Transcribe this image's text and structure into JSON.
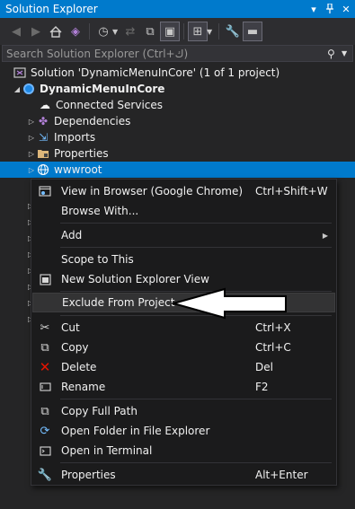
{
  "window": {
    "title": "Solution Explorer",
    "pin_icon": "pin-icon",
    "close_icon": "close-icon"
  },
  "search": {
    "placeholder": "Search Solution Explorer (Ctrl+ك)"
  },
  "tree": {
    "solution": "Solution 'DynamicMenuInCore' (1 of 1 project)",
    "project": "DynamicMenuInCore",
    "items": [
      "Connected Services",
      "Dependencies",
      "Imports",
      "Properties",
      "wwwroot"
    ]
  },
  "context_menu": {
    "items": [
      {
        "label": "View in Browser (Google Chrome)",
        "shortcut": "Ctrl+Shift+W",
        "icon": "browser-icon"
      },
      {
        "label": "Browse With...",
        "shortcut": "",
        "icon": ""
      },
      {
        "label": "Add",
        "shortcut": "",
        "icon": "",
        "submenu": true
      },
      {
        "label": "Scope to This",
        "shortcut": "",
        "icon": ""
      },
      {
        "label": "New Solution Explorer View",
        "shortcut": "",
        "icon": "new-view-icon"
      },
      {
        "label": "Exclude From Project",
        "shortcut": "",
        "icon": "",
        "highlighted": true
      },
      {
        "label": "Cut",
        "shortcut": "Ctrl+X",
        "icon": "scissors-icon"
      },
      {
        "label": "Copy",
        "shortcut": "Ctrl+C",
        "icon": "copy-icon"
      },
      {
        "label": "Delete",
        "shortcut": "Del",
        "icon": "delete-x-icon"
      },
      {
        "label": "Rename",
        "shortcut": "F2",
        "icon": "rename-icon"
      },
      {
        "label": "Copy Full Path",
        "shortcut": "",
        "icon": "copy-path-icon"
      },
      {
        "label": "Open Folder in File Explorer",
        "shortcut": "",
        "icon": "refresh-folder-icon"
      },
      {
        "label": "Open in Terminal",
        "shortcut": "",
        "icon": "terminal-icon"
      },
      {
        "label": "Properties",
        "shortcut": "Alt+Enter",
        "icon": "wrench-icon"
      }
    ]
  },
  "colors": {
    "accent": "#007acc",
    "background": "#252526",
    "menu_bg": "#1b1b1c",
    "delete_red": "#e51400"
  }
}
